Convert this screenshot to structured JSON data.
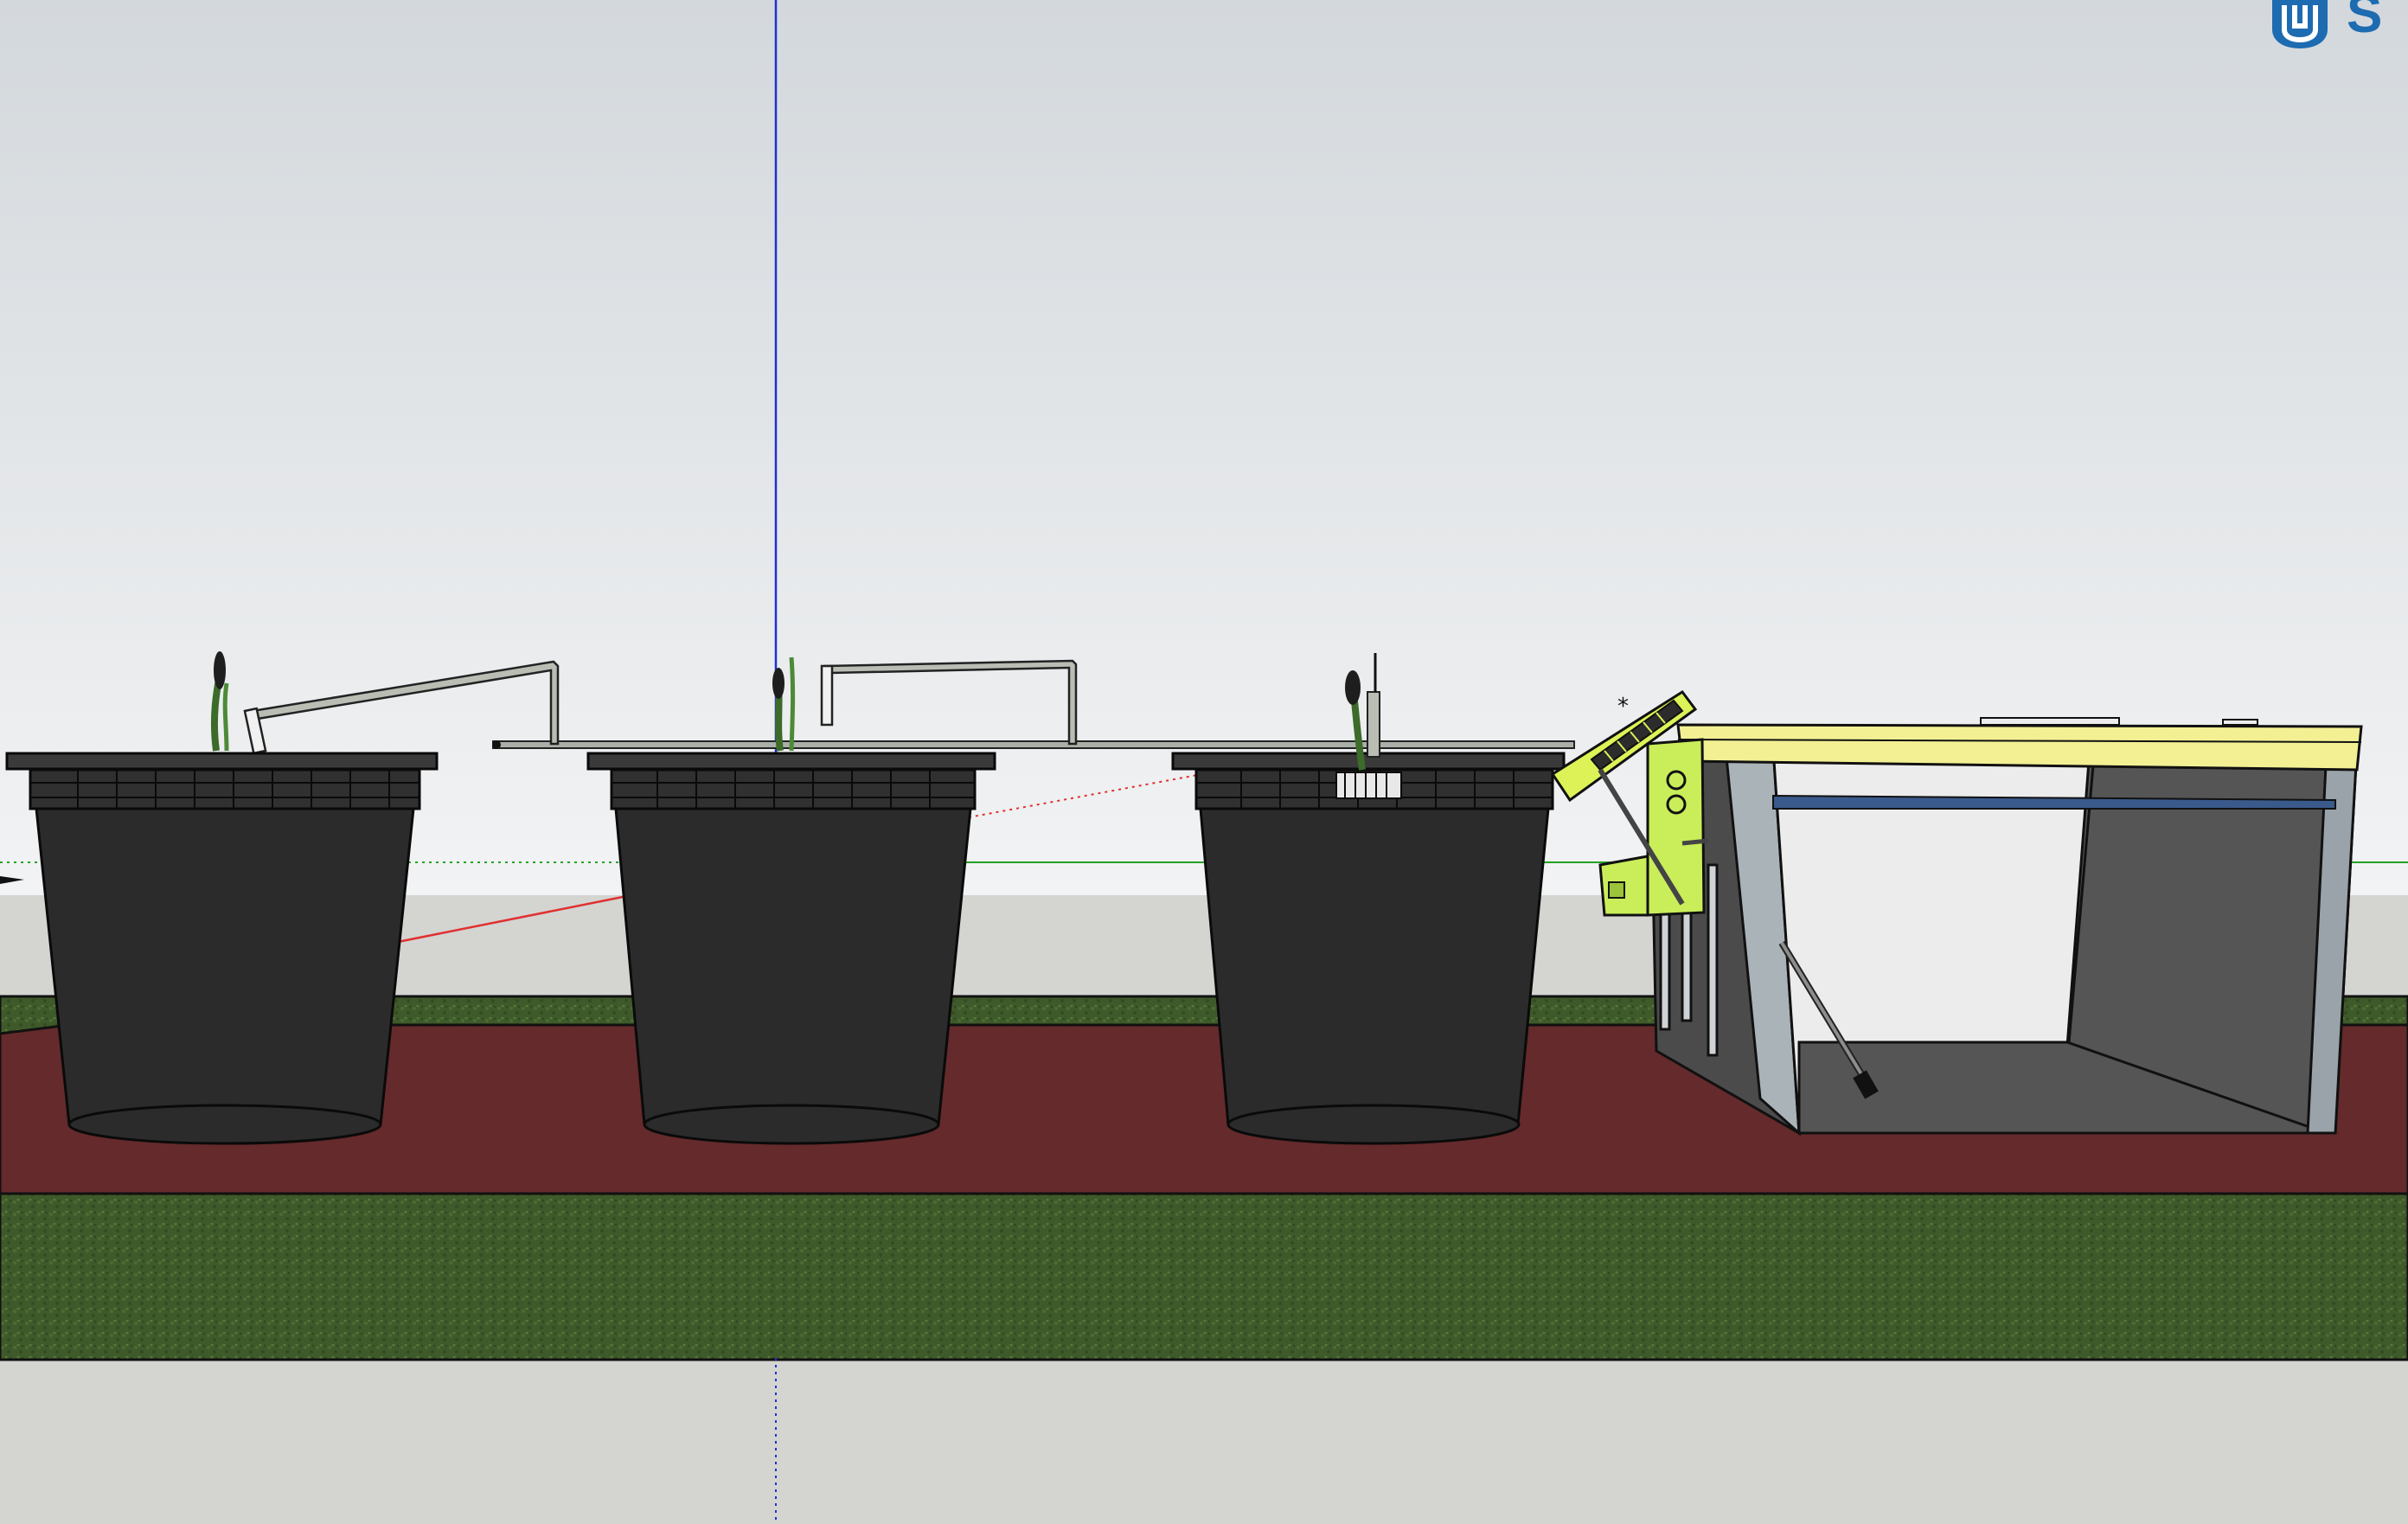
{
  "app": {
    "name": "SketchUp",
    "brand_text_visible": "S"
  },
  "viewport": {
    "style": "hidden-line-shaded",
    "sky_color_top": "#d3d8dc",
    "sky_color_bottom": "#f2f3f4",
    "ground_color": "#d4d4d1",
    "grass_color": "#3f5a2a",
    "path_color": "#652a2b",
    "red_axis_color": "#e03030",
    "green_axis_color": "#28a028",
    "blue_axis_color": "#2030d0",
    "brand_color": "#1d6bb1"
  },
  "model": {
    "buckets": [
      {
        "name": "bucket-1"
      },
      {
        "name": "bucket-2"
      },
      {
        "name": "bucket-3"
      }
    ],
    "plants": [
      "sprout-1",
      "sprout-2",
      "sprout-3"
    ],
    "solar_panel_color": "#ddf257",
    "bracket_color": "#c9ee5a",
    "cabinet_top_color": "#f3f094",
    "cabinet_side_color": "#9aa3a9",
    "cabinet_inner_color": "#555555"
  }
}
